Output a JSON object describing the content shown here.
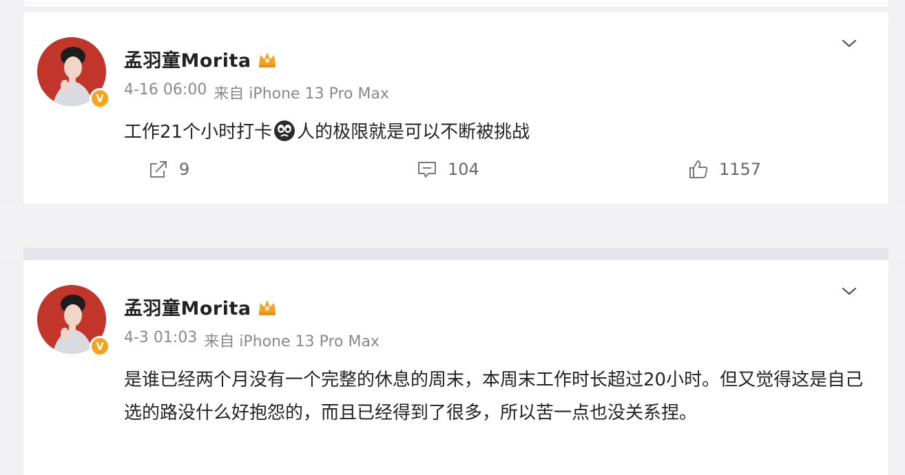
{
  "posts": [
    {
      "username": "孟羽童Morita",
      "timestamp": "4-16 06:00",
      "source": "来自 iPhone 13 Pro Max",
      "text_before_emoji": "工作21个小时打卡",
      "text_after_emoji": "人的极限就是可以不断被挑战",
      "reposts": "9",
      "comments": "104",
      "likes": "1157"
    },
    {
      "username": "孟羽童Morita",
      "timestamp": "4-3 01:03",
      "source": "来自 iPhone 13 Pro Max",
      "text": "是谁已经两个月没有一个完整的休息的周末，本周末工作时长超过20小时。但又觉得这是自己选的路没什么好抱怨的，而且已经得到了很多，所以苦一点也没关系捏。"
    }
  ],
  "colors": {
    "accent_gold": "#f6a21d",
    "avatar_red": "#c93a2d",
    "text_primary": "#222222",
    "text_meta": "#888888"
  },
  "icons": {
    "verified": "verified-v-icon",
    "member_crown": "crown-icon",
    "menu": "chevron-down-icon",
    "repost": "repost-icon",
    "comment": "comment-icon",
    "like": "thumbs-up-icon",
    "emoji": "crying-face-emoji"
  },
  "badge_letter": "V"
}
